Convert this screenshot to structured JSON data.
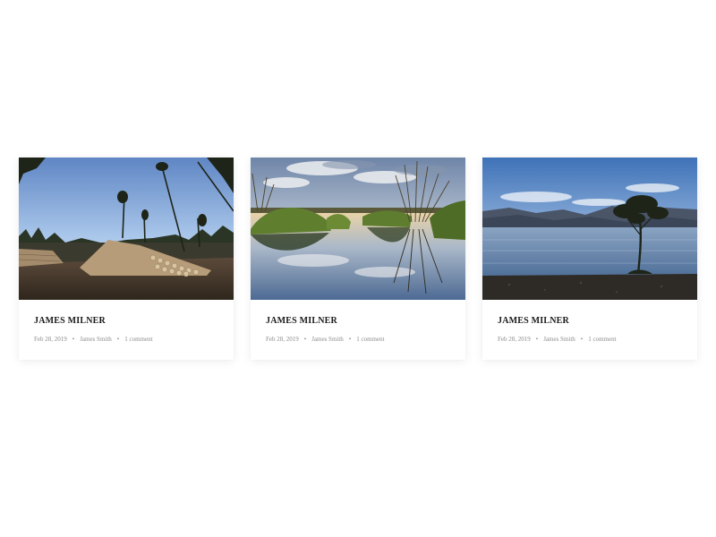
{
  "cards": [
    {
      "image_alt": "log pile in a cleared forest",
      "title": "JAMES MILNER",
      "date": "Feb 28, 2019",
      "author": "James Smith",
      "comments": "1 comment",
      "separator": "•"
    },
    {
      "image_alt": "reeds reflected in a still pond",
      "title": "JAMES MILNER",
      "date": "Feb 28, 2019",
      "author": "James Smith",
      "comments": "1 comment",
      "separator": "•"
    },
    {
      "image_alt": "lone tree by a mountain lake",
      "title": "JAMES MILNER",
      "date": "Feb 28, 2019",
      "author": "James Smith",
      "comments": "1 comment",
      "separator": "•"
    }
  ],
  "colors": {
    "title": "#1a1a1a",
    "meta": "#8c8c8c",
    "shadow": "rgba(0,0,0,0.07)"
  }
}
